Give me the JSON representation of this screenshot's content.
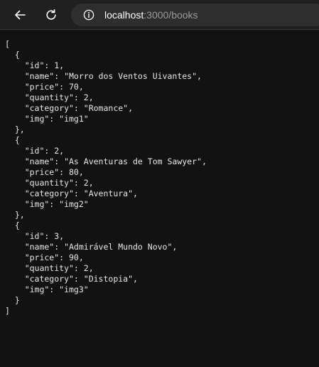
{
  "browser": {
    "url_host": "localhost",
    "url_rest": ":3000/books"
  },
  "icons": {
    "back": "arrow-left-icon",
    "reload": "reload-icon",
    "info": "info-circle-icon"
  },
  "json_lines": [
    "[",
    "  {",
    "    \"id\": 1,",
    "    \"name\": \"Morro dos Ventos Uivantes\",",
    "    \"price\": 70,",
    "    \"quantity\": 2,",
    "    \"category\": \"Romance\",",
    "    \"img\": \"img1\"",
    "  },",
    "  {",
    "    \"id\": 2,",
    "    \"name\": \"As Aventuras de Tom Sawyer\",",
    "    \"price\": 80,",
    "    \"quantity\": 2,",
    "    \"category\": \"Aventura\",",
    "    \"img\": \"img2\"",
    "  },",
    "  {",
    "    \"id\": 3,",
    "    \"name\": \"Admirável Mundo Novo\",",
    "    \"price\": 90,",
    "    \"quantity\": 2,",
    "    \"category\": \"Distopia\",",
    "    \"img\": \"img3\"",
    "  }",
    "]"
  ]
}
